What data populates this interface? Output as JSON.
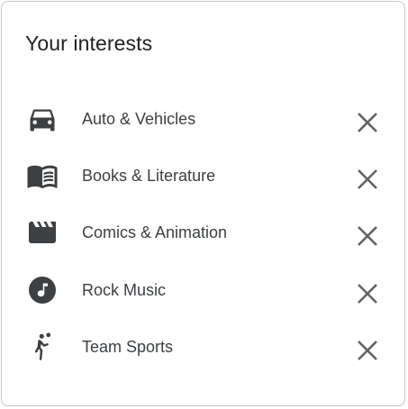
{
  "card": {
    "title": "Your interests",
    "items": [
      {
        "label": "Auto & Vehicles",
        "icon": "car-icon"
      },
      {
        "label": "Books & Literature",
        "icon": "book-icon"
      },
      {
        "label": "Comics & Animation",
        "icon": "clapperboard-icon"
      },
      {
        "label": "Rock Music",
        "icon": "music-note-icon"
      },
      {
        "label": "Team Sports",
        "icon": "sports-player-icon"
      }
    ],
    "remove_icon": "close-icon"
  },
  "colors": {
    "icon": "#3c4043",
    "text": "#3c4043",
    "title": "#202124",
    "border": "#c8c8c8",
    "close": "#5f6368"
  }
}
